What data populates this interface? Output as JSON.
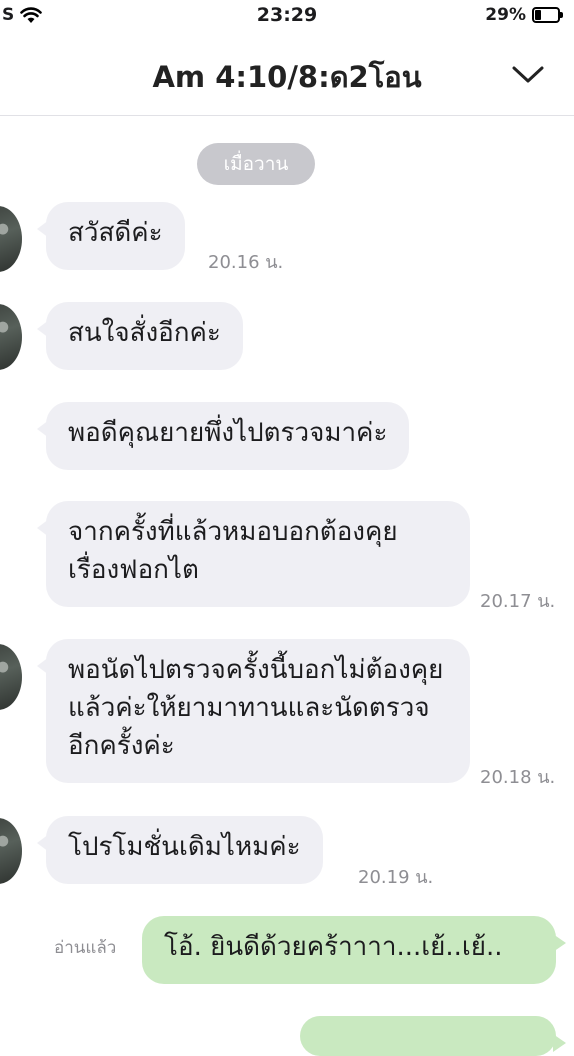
{
  "status_bar": {
    "carrier": "S",
    "time": "23:29",
    "battery_text": "29%",
    "battery_level": 0.29
  },
  "header": {
    "title": "Am 4:10/8:ด2โอน",
    "chevron_icon": "chevron-down-icon"
  },
  "chat": {
    "date_separator": "เมื่อวาน",
    "messages": [
      {
        "text": "สวัสดีค่ะ",
        "time": "20.16 น."
      },
      {
        "text": "สนใจสั่งอีกค่ะ",
        "time": ""
      },
      {
        "text": "พอดีคุณยายพึ่งไปตรวจมาค่ะ",
        "time": ""
      },
      {
        "text": "จากครั้งที่แล้วหมอบอกต้องคุยเรื่องฟอกไต",
        "time": "20.17 น."
      },
      {
        "text": "พอนัดไปตรวจครั้งนี้บอกไม่ต้องคุยแล้วค่ะให้ยามาทานและนัดตรวจอีกครั้งค่ะ",
        "time": "20.18 น."
      },
      {
        "text": "โปรโมชั่นเดิมไหมค่ะ",
        "time": "20.19 น."
      }
    ],
    "outgoing": [
      {
        "text": "โอ้. ยินดีด้วยคร้าาาา...เย้..เย้..",
        "read_label": "อ่านแล้ว"
      }
    ]
  }
}
